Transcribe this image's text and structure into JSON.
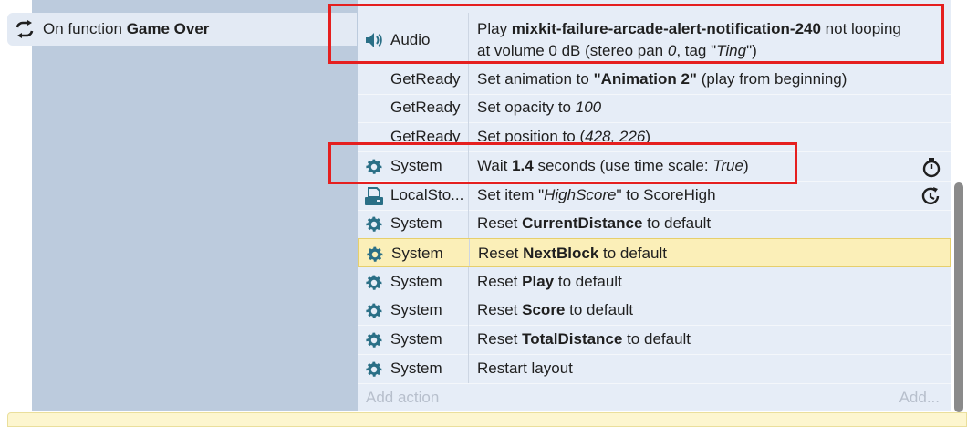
{
  "condition": {
    "prefix": "On function",
    "name": "Game Over",
    "icon": "function-loop-icon"
  },
  "actions_header": {
    "ghost_left": "Add action",
    "ghost_right": "Add..."
  },
  "actions": [
    {
      "object": "Audio",
      "icon": "speaker-icon",
      "line1_pre": "Play ",
      "line1_bold": "mixkit-failure-arcade-alert-notification-240",
      "line1_post": " not looping",
      "line2_pre": "at volume 0 dB (stereo pan ",
      "line2_ital": "0",
      "line2_mid": ", tag \"",
      "line2_ital2": "Ting",
      "line2_post": "\")"
    },
    {
      "object": "GetReady",
      "pre": "Set animation to ",
      "bold": "\"Animation 2\"",
      "post": " (play from beginning)"
    },
    {
      "object": "GetReady",
      "pre": "Set opacity to ",
      "ital": "100"
    },
    {
      "object": "GetReady",
      "pre": "Set position to (",
      "ital": "428, 226",
      "post": ")"
    },
    {
      "object": "System",
      "icon": "gear-icon",
      "pre": "Wait ",
      "bold": "1.4",
      "mid": " seconds (use time scale: ",
      "ital": "True",
      "post": ")",
      "right_icon": "stopwatch-icon"
    },
    {
      "object": "LocalSto...",
      "icon": "local-storage-icon",
      "pre": "Set item \"",
      "ital": "HighScore",
      "post": "\" to ScoreHigh",
      "right_icon": "async-clock-icon"
    },
    {
      "object": "System",
      "icon": "gear-icon",
      "pre": "Reset ",
      "bold": "CurrentDistance",
      "post": " to default"
    },
    {
      "object": "System",
      "icon": "gear-icon",
      "pre": "Reset ",
      "bold": "NextBlock",
      "post": " to default",
      "selected": true
    },
    {
      "object": "System",
      "icon": "gear-icon",
      "pre": "Reset ",
      "bold": "Play",
      "post": " to default"
    },
    {
      "object": "System",
      "icon": "gear-icon",
      "pre": "Reset ",
      "bold": "Score",
      "post": " to default"
    },
    {
      "object": "System",
      "icon": "gear-icon",
      "pre": "Reset ",
      "bold": "TotalDistance",
      "post": " to default"
    },
    {
      "object": "System",
      "icon": "gear-icon",
      "pre": "Restart layout"
    }
  ],
  "add_row": {
    "add_action": "Add action",
    "add_more": "Add..."
  },
  "colors": {
    "highlight": "#e51f1f",
    "selected_row": "#fbefb8",
    "gear": "#2a6f86"
  }
}
